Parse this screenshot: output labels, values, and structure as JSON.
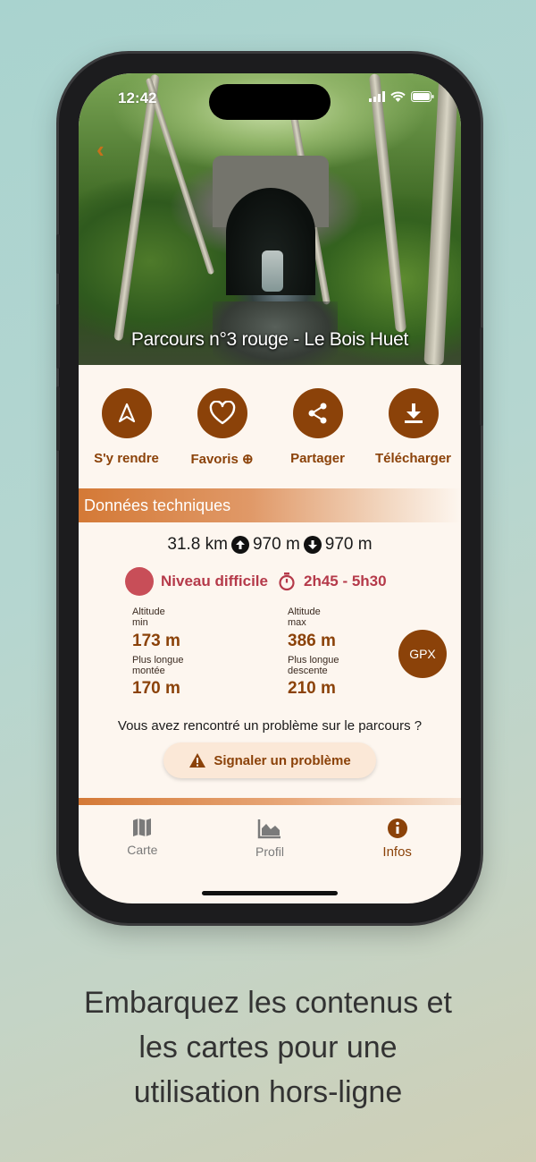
{
  "status_bar": {
    "time": "12:42"
  },
  "trail": {
    "title": "Parcours n°3 rouge - Le Bois Huet"
  },
  "actions": [
    {
      "label": "S'y rendre",
      "icon": "navigation-arrow-icon"
    },
    {
      "label": "Favoris ⊕",
      "icon": "heart-icon"
    },
    {
      "label": "Partager",
      "icon": "share-icon"
    },
    {
      "label": "Télécharger",
      "icon": "download-icon"
    }
  ],
  "section": {
    "title": "Données techniques"
  },
  "stats": {
    "distance": "31.8 km",
    "ascent": "970 m",
    "descent": "970 m",
    "level": "Niveau difficile",
    "duration": "2h45 - 5h30"
  },
  "metrics": {
    "alt_min_label_1": "Altitude",
    "alt_min_label_2": "min",
    "alt_min_value": "173 m",
    "alt_max_label_1": "Altitude",
    "alt_max_label_2": "max",
    "alt_max_value": "386 m",
    "climb_label_1": "Plus longue",
    "climb_label_2": "montée",
    "climb_value": "170 m",
    "desc_label_1": "Plus longue",
    "desc_label_2": "descente",
    "desc_value": "210 m",
    "gpx": "GPX"
  },
  "problem": {
    "question": "Vous avez rencontré un problème sur le parcours ?",
    "button": "Signaler un problème"
  },
  "tabs": [
    {
      "label": "Carte",
      "icon": "map-icon"
    },
    {
      "label": "Profil",
      "icon": "chart-area-icon"
    },
    {
      "label": "Infos",
      "icon": "info-icon"
    }
  ],
  "caption": {
    "line1": "Embarquez les contenus et",
    "line2": "les cartes pour une",
    "line3": "utilisation hors-ligne"
  },
  "colors": {
    "accent": "#8b4209",
    "difficulty": "#c84e58",
    "section_gradient": "#d47936",
    "screen_bg": "#fdf6ef"
  }
}
